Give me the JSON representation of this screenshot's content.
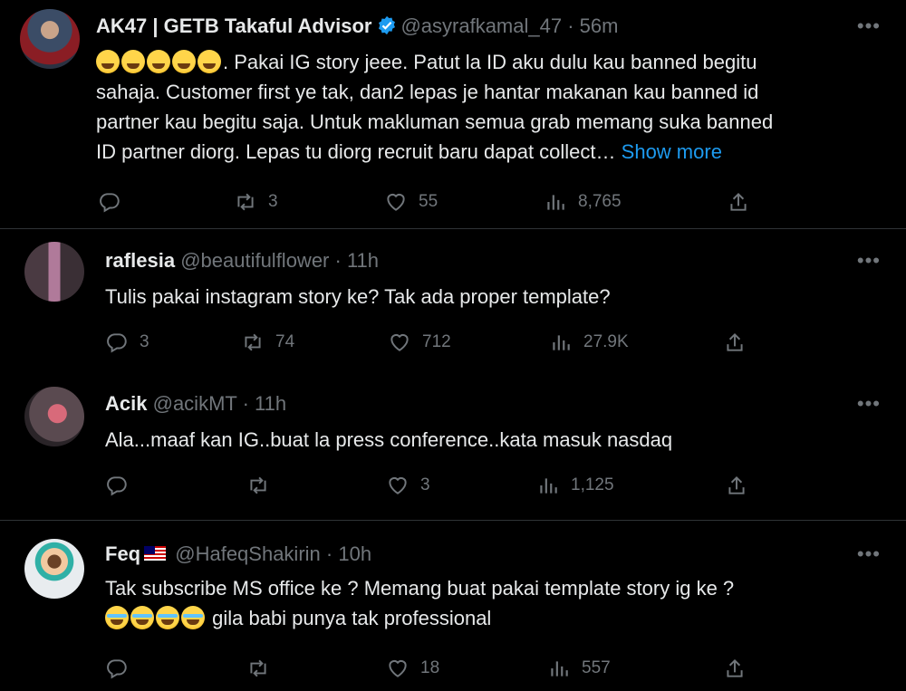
{
  "tweets": [
    {
      "name": "AK47 | GETB Takaful Advisor",
      "handle": "@asyrafkamal_47",
      "time": "· 56m",
      "body_line1": ". Pakai IG story jeee. Patut la ID aku dulu kau banned begitu",
      "body_line2": "sahaja. Customer first ye tak, dan2 lepas je hantar makanan kau banned id",
      "body_line3": "partner kau begitu saja. Untuk makluman semua grab memang suka banned",
      "body_line4": "ID partner diorg. Lepas tu diorg recruit baru dapat collect…",
      "show_more": "Show more",
      "replies": "",
      "retweets": "3",
      "likes": "55",
      "views": "8,765"
    },
    {
      "name": "raflesia",
      "handle": "@beautifulflower",
      "time": "· 11h",
      "body": "Tulis pakai instagram story ke? Tak ada proper template?",
      "replies": "3",
      "retweets": "74",
      "likes": "712",
      "views": "27.9K"
    },
    {
      "name": "Acik",
      "handle": "@acikMT",
      "time": "· 11h",
      "body": "Ala...maaf kan IG..buat la press conference..kata masuk nasdaq",
      "replies": "",
      "retweets": "",
      "likes": "3",
      "views": "1,125"
    },
    {
      "name": "Feq",
      "handle": "@HafeqShakirin",
      "time": "· 10h",
      "body_line1": "Tak subscribe MS office ke ? Memang buat pakai template story ig ke ?",
      "body_line2": " gila babi punya tak professional",
      "replies": "",
      "retweets": "",
      "likes": "18",
      "views": "557"
    }
  ],
  "more_label": "•••",
  "icons": [
    "reply-icon",
    "retweet-icon",
    "like-icon",
    "views-icon",
    "share-icon",
    "verified-icon",
    "flag-my-icon"
  ],
  "colors": {
    "background": "#000000",
    "text": "#e7e9ea",
    "muted": "#71767b",
    "link": "#1d9bf0",
    "divider": "#2f3336"
  }
}
